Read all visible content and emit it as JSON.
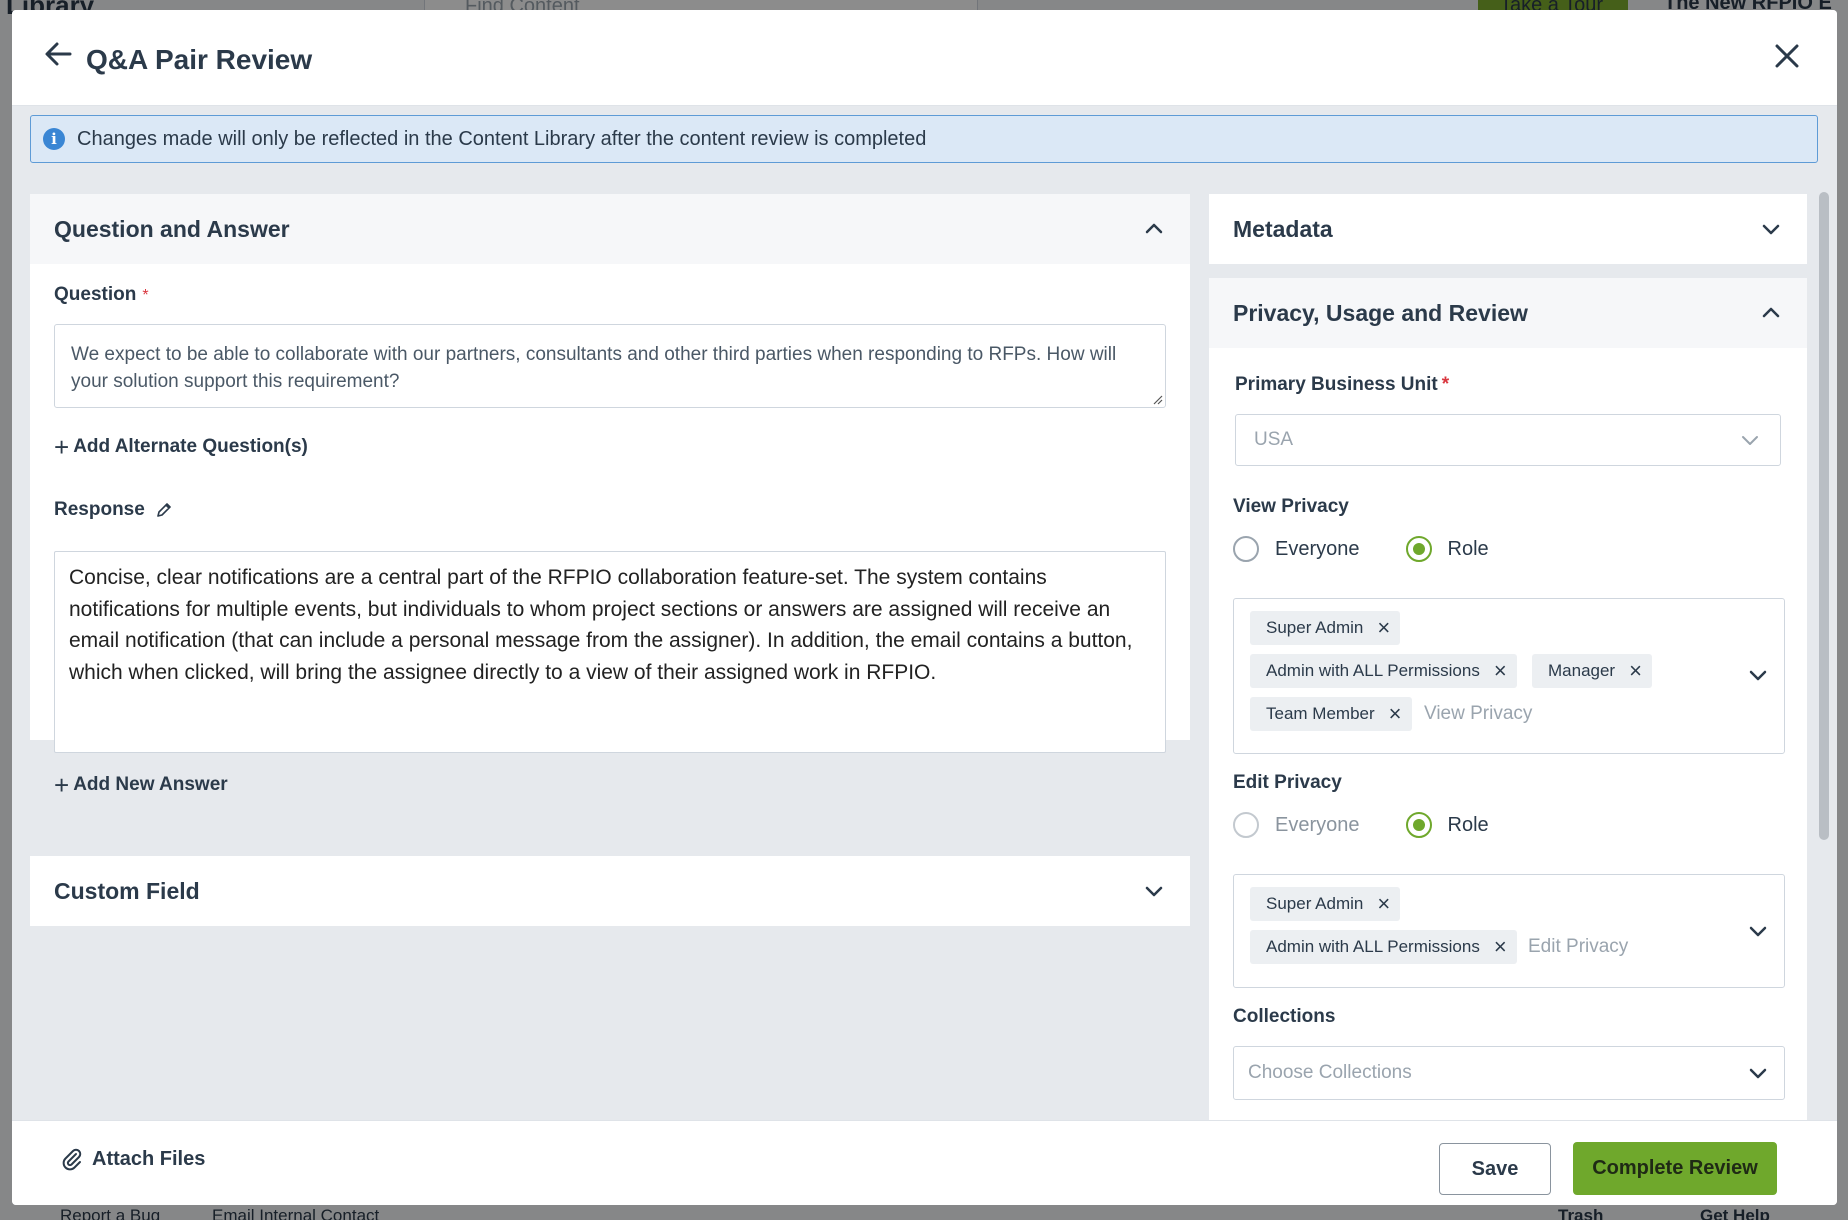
{
  "background": {
    "title": "Library",
    "search_placeholder": "Find Content",
    "tour_button": "Take a Tour",
    "new_label": "The New RFPIO E",
    "footer_links": [
      "Report a Bug",
      "Email Internal Contact",
      "Trash",
      "Get Help"
    ]
  },
  "header": {
    "title": "Q&A Pair Review"
  },
  "info": {
    "message": "Changes made will only be reflected in the Content Library after the content review is completed"
  },
  "qa": {
    "section_title": "Question and Answer",
    "question_label": "Question",
    "question_text": "We expect to be able to collaborate with our partners, consultants and other third parties when responding to RFPs. How will your solution support this requirement?",
    "add_alternate": "Add Alternate Question(s)",
    "response_label": "Response",
    "response_text": "Concise, clear notifications are a central part of the RFPIO collaboration feature-set. The system contains notifications for multiple events, but individuals to whom project sections or answers are assigned will receive an email notification (that can include a personal message from the assigner). In addition, the email contains a button, which when clicked, will bring the assignee directly to a view of their assigned work in RFPIO.",
    "add_answer": "Add New Answer"
  },
  "custom_field": {
    "title": "Custom Field"
  },
  "metadata": {
    "title": "Metadata"
  },
  "privacy": {
    "title": "Privacy, Usage and Review",
    "business_unit_label": "Primary Business Unit",
    "business_unit_value": "USA",
    "view_privacy_label": "View Privacy",
    "view_options": [
      "Everyone",
      "Role"
    ],
    "view_selected": "Role",
    "view_tags": [
      "Super Admin",
      "Admin with ALL Permissions",
      "Manager",
      "Team Member"
    ],
    "view_placeholder": "View Privacy",
    "edit_privacy_label": "Edit Privacy",
    "edit_options": [
      "Everyone",
      "Role"
    ],
    "edit_selected": "Role",
    "edit_tags": [
      "Super Admin",
      "Admin with ALL Permissions"
    ],
    "edit_placeholder": "Edit Privacy",
    "collections_label": "Collections",
    "collections_placeholder": "Choose Collections"
  },
  "footer": {
    "attach": "Attach Files",
    "save": "Save",
    "complete": "Complete Review"
  },
  "colors": {
    "accent_green": "#6fa82c",
    "info_blue": "#3a86d4",
    "required_red": "#d9363e"
  }
}
